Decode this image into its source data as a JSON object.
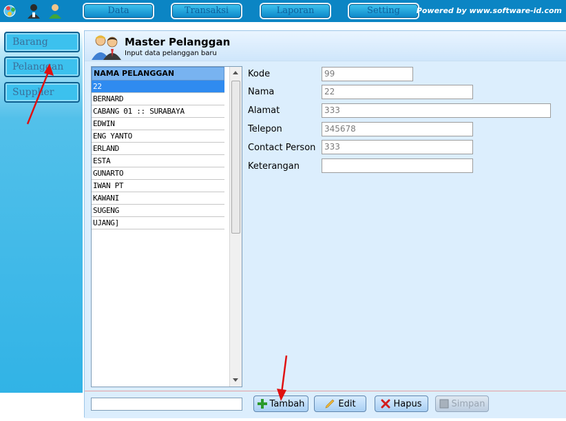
{
  "topbar": {
    "icons": [
      "globe-people-icon",
      "user-dark-icon",
      "user-green-icon"
    ],
    "menu": [
      {
        "label": "Data"
      },
      {
        "label": "Transaksi"
      },
      {
        "label": "Laporan"
      },
      {
        "label": "Setting"
      }
    ],
    "powered": "Powered by www.software-id.com"
  },
  "sidebar": {
    "items": [
      {
        "label": "Barang"
      },
      {
        "label": "Pelanggan"
      },
      {
        "label": "Supplier"
      }
    ]
  },
  "header": {
    "title": "Master Pelanggan",
    "subtitle": "Input data pelanggan baru"
  },
  "list": {
    "column": "NAMA PELANGGAN",
    "items": [
      "22",
      "BERNARD",
      "CABANG 01 :: SURABAYA",
      "EDWIN",
      "ENG YANTO",
      "ERLAND",
      "ESTA",
      "GUNARTO",
      "IWAN PT",
      "KAWANI",
      "SUGENG",
      "UJANG]"
    ],
    "selected_index": 0
  },
  "form": {
    "kode": {
      "label": "Kode",
      "value": "99"
    },
    "nama": {
      "label": "Nama",
      "value": "22"
    },
    "alamat": {
      "label": "Alamat",
      "value": "333"
    },
    "telepon": {
      "label": "Telepon",
      "value": "345678"
    },
    "contact": {
      "label": "Contact Person",
      "value": "333"
    },
    "keterangan": {
      "label": "Keterangan",
      "value": ""
    }
  },
  "buttons": {
    "tambah": "Tambah",
    "edit": "Edit",
    "hapus": "Hapus",
    "simpan": "Simpan"
  },
  "colors": {
    "topbar": "#0b85c4",
    "panel": "#dceefd",
    "selection": "#2f8bf0",
    "annotation": "#e01010"
  }
}
